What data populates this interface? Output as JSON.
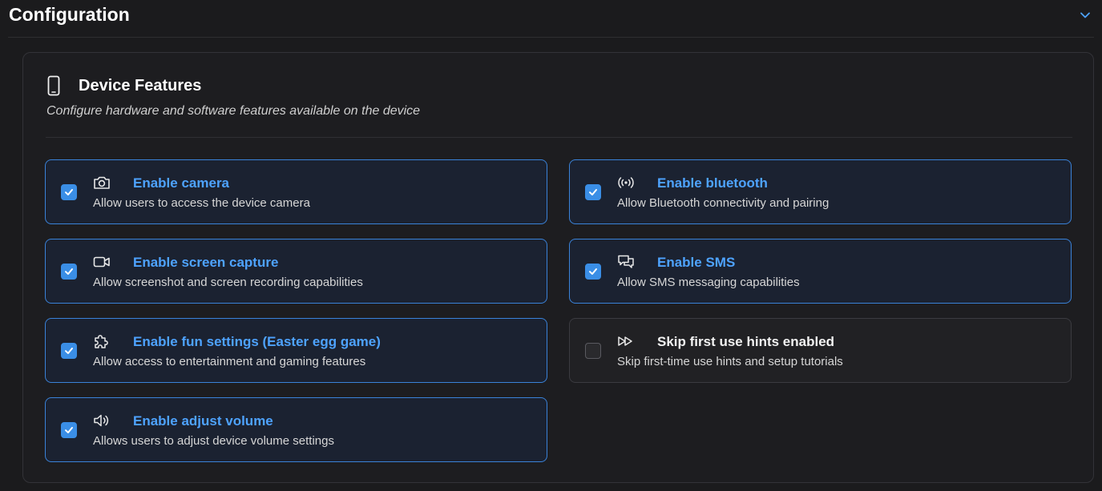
{
  "header": {
    "title": "Configuration"
  },
  "card": {
    "title": "Device Features",
    "subtitle": "Configure hardware and software features available on the device"
  },
  "colors": {
    "accent": "#4ea3ff",
    "checkbox_on": "#3a8ee6",
    "card_border_on": "#3a82d8",
    "background": "#1b1b1d"
  },
  "features": [
    {
      "icon": "camera-icon",
      "title": "Enable camera",
      "description": "Allow users to access the device camera",
      "checked": true
    },
    {
      "icon": "bluetooth-icon",
      "title": "Enable bluetooth",
      "description": "Allow Bluetooth connectivity and pairing",
      "checked": true
    },
    {
      "icon": "video-icon",
      "title": "Enable screen capture",
      "description": "Allow screenshot and screen recording capabilities",
      "checked": true
    },
    {
      "icon": "chat-icon",
      "title": "Enable SMS",
      "description": "Allow SMS messaging capabilities",
      "checked": true
    },
    {
      "icon": "puzzle-icon",
      "title": "Enable fun settings (Easter egg game)",
      "description": "Allow access to entertainment and gaming features",
      "checked": true
    },
    {
      "icon": "fast-forward-icon",
      "title": "Skip first use hints enabled",
      "description": "Skip first-time use hints and setup tutorials",
      "checked": false
    },
    {
      "icon": "volume-icon",
      "title": "Enable adjust volume",
      "description": "Allows users to adjust device volume settings",
      "checked": true
    }
  ]
}
